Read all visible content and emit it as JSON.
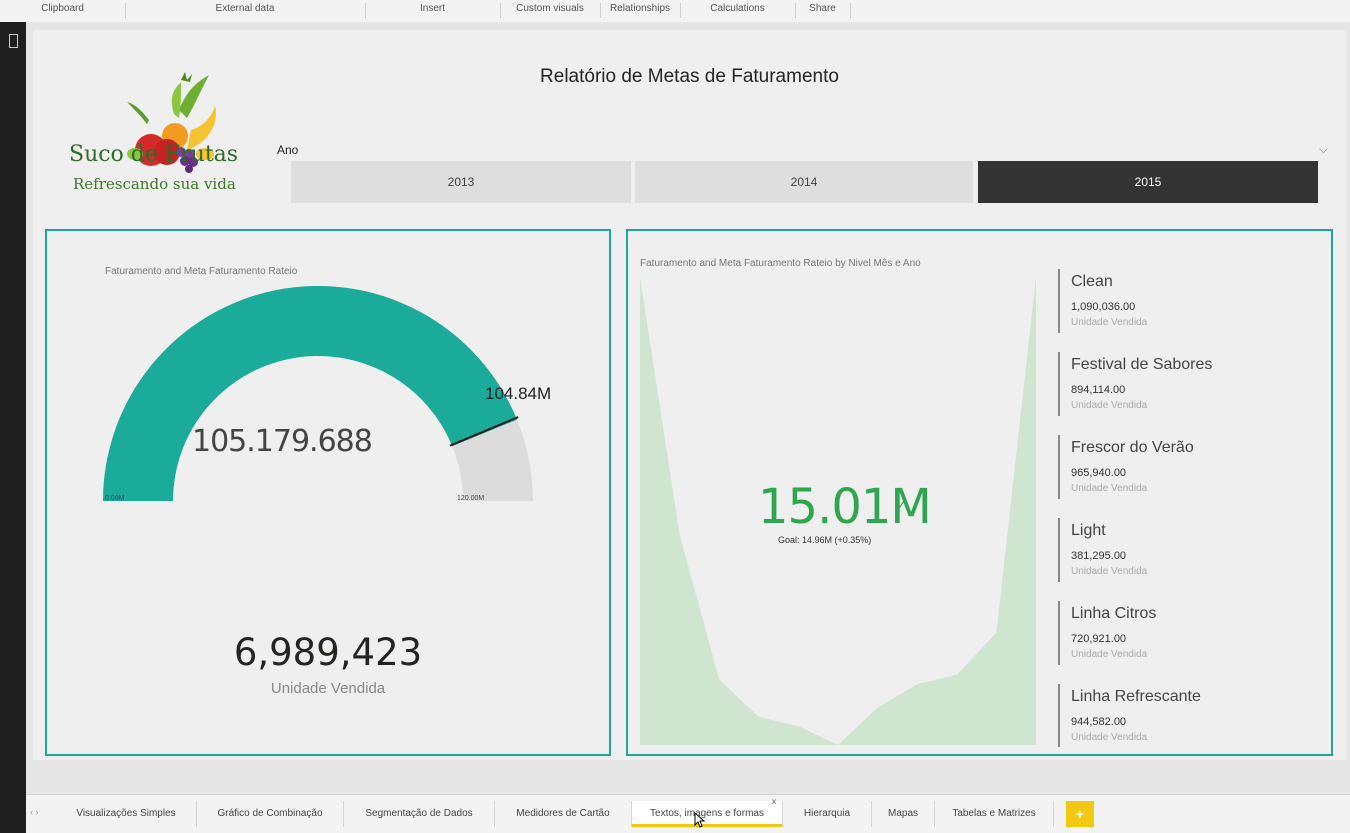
{
  "ribbon": {
    "groups": [
      "Clipboard",
      "External data",
      "Insert",
      "Custom visuals",
      "Relationships",
      "Calculations",
      "Share"
    ]
  },
  "report": {
    "title": "Relatório de Metas de Faturamento"
  },
  "logo": {
    "brand": "Suco de Frutas",
    "tagline": "Refrescando sua vida"
  },
  "slicer": {
    "label": "Ano",
    "options": [
      "2013",
      "2014",
      "2015"
    ],
    "selected": "2015"
  },
  "gauge": {
    "title": "Faturamento and Meta Faturamento Rateio",
    "value_label": "105.179.688",
    "target_label": "104.84M",
    "min_label": "0.00M",
    "max_label": "120.00M",
    "value": 105179688,
    "target": 104840000,
    "min": 0,
    "max": 120000000,
    "fill_color": "#1aab9b",
    "track_color": "#dcdcdc"
  },
  "card": {
    "value": "6,989,423",
    "label": "Unidade Vendida"
  },
  "kpi": {
    "title": "Faturamento and Meta Faturamento Rateio by Nivel Mês e Ano",
    "value": "15.01M",
    "goal": "Goal: 14.96M (+0.35%)",
    "color": "#2fa54f",
    "trend": [
      100,
      45,
      14,
      6,
      4,
      0,
      8,
      13,
      15,
      24,
      100
    ]
  },
  "multirow": {
    "items": [
      {
        "name": "Clean",
        "value": "1,090,036.00",
        "label": "Unidade Vendida"
      },
      {
        "name": "Festival de Sabores",
        "value": "894,114.00",
        "label": "Unidade Vendida"
      },
      {
        "name": "Frescor do Verão",
        "value": "965,940.00",
        "label": "Unidade Vendida"
      },
      {
        "name": "Light",
        "value": "381,295.00",
        "label": "Unidade Vendida"
      },
      {
        "name": "Linha Citros",
        "value": "720,921.00",
        "label": "Unidade Vendida"
      },
      {
        "name": "Linha Refrescante",
        "value": "944,582.00",
        "label": "Unidade Vendida"
      }
    ]
  },
  "tabs": {
    "items": [
      "Visualizações Simples",
      "Gráfico de Combinação",
      "Segmentação de Dados",
      "Medidores de Cartão",
      "Textos, imagens e formas",
      "Hierarquia",
      "Mapas",
      "Tabelas e Matrizes"
    ],
    "active": "Textos, imagens e formas",
    "add_label": "+",
    "close_label": "x"
  },
  "colors": {
    "panel_border": "#1fa89a",
    "active_tab_accent": "#f2c811"
  }
}
